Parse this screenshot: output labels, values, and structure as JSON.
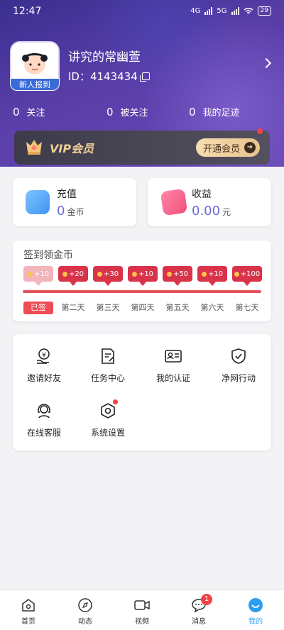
{
  "status_bar": {
    "time": "12:47",
    "network": "4G",
    "network2": "5G",
    "battery": "29"
  },
  "profile": {
    "name": "讲究的常幽萱",
    "id_text": "ID：4143434",
    "badge": "新人报到"
  },
  "stats": [
    {
      "count": "0",
      "label": "关注"
    },
    {
      "count": "0",
      "label": "被关注"
    },
    {
      "count": "0",
      "label": "我的足迹"
    }
  ],
  "vip": {
    "label": "VIP会员",
    "button": "开通会员"
  },
  "wallet": {
    "recharge": {
      "title": "充值",
      "value": "0",
      "unit": "金币"
    },
    "income": {
      "title": "收益",
      "value": "0.00",
      "unit": "元"
    }
  },
  "checkin": {
    "title": "签到领金币",
    "rewards": [
      "+10",
      "+20",
      "+30",
      "+10",
      "+50",
      "+10",
      "+100"
    ],
    "days": [
      "已签",
      "第二天",
      "第三天",
      "第四天",
      "第五天",
      "第六天",
      "第七天"
    ]
  },
  "tools": [
    {
      "label": "邀请好友",
      "icon": "invite-friends-icon"
    },
    {
      "label": "任务中心",
      "icon": "task-center-icon"
    },
    {
      "label": "我的认证",
      "icon": "id-card-icon"
    },
    {
      "label": "净网行动",
      "icon": "shield-check-icon"
    },
    {
      "label": "在线客服",
      "icon": "customer-service-icon"
    },
    {
      "label": "系统设置",
      "icon": "settings-icon"
    }
  ],
  "tabbar": [
    {
      "label": "首页",
      "icon": "home-icon"
    },
    {
      "label": "动态",
      "icon": "compass-icon"
    },
    {
      "label": "视频",
      "icon": "video-icon"
    },
    {
      "label": "消息",
      "icon": "message-icon",
      "badge": "1"
    },
    {
      "label": "我的",
      "icon": "profile-icon"
    }
  ],
  "colors": {
    "accent": "#2a9df0",
    "header": "#5a3ea8",
    "checkin_red": "#d9334a",
    "vip_gold": "#f1cf97"
  }
}
